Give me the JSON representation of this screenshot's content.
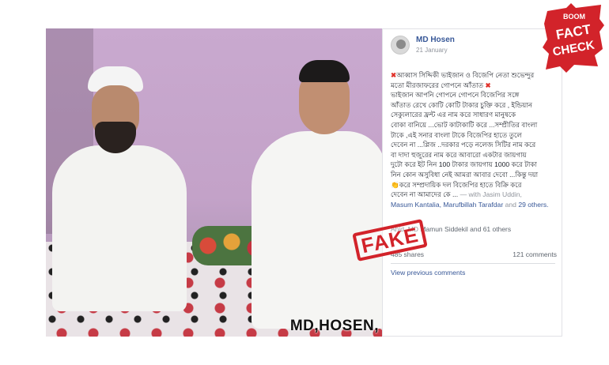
{
  "photo": {
    "watermark": "MD,HOSEN,"
  },
  "post": {
    "author": "MD Hosen",
    "date": "21 January",
    "body_lines": [
      "আব্বাস সিদ্দিকী ভাইজান ও বিজেপি নেতা শুভেন্দুর",
      "মতো মীরজাফরের গোপনে আঁতাত",
      "ভাইজান আপনি গোপনে গোপনে বিজেপির সঙ্গে",
      "আঁতাত রেখে কোটি কোটি টাকার চুক্তি করে , ইন্ডিয়ান",
      "সেক্যুলারের ফ্রন্ট এর নাম করে সাধারণ মানুষকে",
      "বোকা বানিয়ে ...ভোট কাটাকাটি করে ...সম্প্রীতির বাংলা",
      "টাকে ,এই সনার বাংলা টাকে বিজেপির হাতে তুলে",
      "দেবেন না ...প্লিজ ..দরকার পড়ে নলেজ সিটির নাম করে",
      "বা দাদা হুজুরের নাম করে আবারো একটার জায়গায়",
      "দুটো করে ইট নিন 100 টাকার জায়গায় 1000 করে টাকা",
      "নিন কোন অসুবিধা নেই আমরা আবার দেবো ...কিন্তু দয়া",
      "করে সম্প্রদায়িক দল বিজেপির হাতে বিক্রি করে",
      "দেবেন না আমাদের কে ..."
    ],
    "with_prefix": "— with Jasim Uddin,",
    "with_tagged": "Masum Kantalia, Marufbillah Tarafdar",
    "with_and": "and",
    "with_others": "29 others.",
    "reactions": "Ahid, MD Mamun Siddekil and 61 others",
    "shares": "485 shares",
    "comments": "121 comments",
    "view_previous": "View previous comments"
  },
  "stamp": {
    "label": "FAKE"
  },
  "badge": {
    "top": "BOOM",
    "line1": "FACT",
    "line2": "CHECK"
  },
  "colors": {
    "fb_blue": "#385898",
    "stamp_red": "#d2232a"
  }
}
